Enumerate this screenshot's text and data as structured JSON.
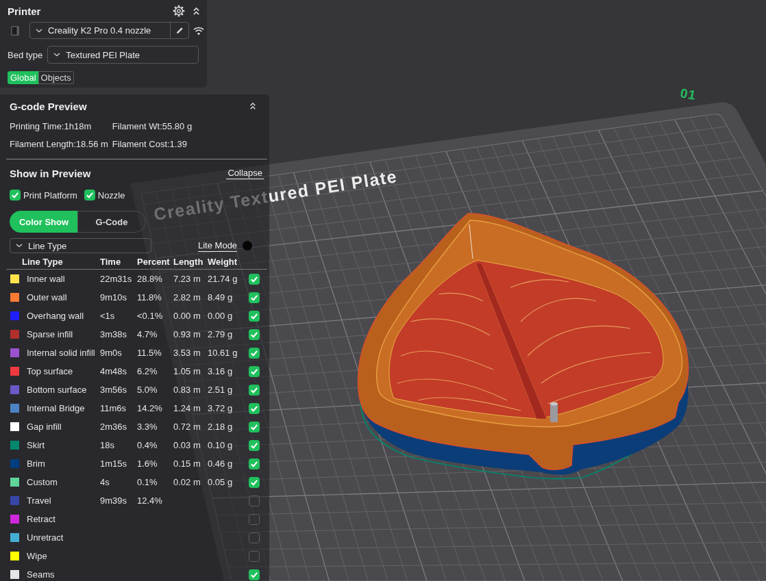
{
  "printer_panel": {
    "title": "Printer",
    "printer": "Creality K2 Pro 0.4 nozzle",
    "bed_type_label": "Bed type",
    "bed_type": "Textured PEI Plate",
    "tabs": [
      {
        "label": "Global",
        "selected": true
      },
      {
        "label": "Objects",
        "selected": false
      }
    ]
  },
  "gcode_panel": {
    "title": "G-code Preview",
    "stats": [
      "Printing Time:1h18m",
      "Filament Wt:55.80 g",
      "Filament Length:18.56 m",
      "Filament Cost:1.39"
    ],
    "show_in_preview": {
      "title": "Show in Preview",
      "collapse_link": "Collapse",
      "options": [
        {
          "label": "Print Platform",
          "checked": true
        },
        {
          "label": "Nozzle",
          "checked": true
        }
      ],
      "modes": [
        {
          "label": "Color Show",
          "selected": true
        },
        {
          "label": "G-Code",
          "selected": false
        }
      ],
      "view_type": "Line Type",
      "lite_mode_link": "Lite Mode"
    },
    "table": {
      "columns": [
        "Line Type",
        "Time",
        "Percent",
        "Length",
        "Weight"
      ],
      "rows": [
        {
          "name": "Inner wall",
          "color": "#ffe34d",
          "time": "22m31s",
          "percent": "28.8%",
          "length": "7.23 m",
          "weight": "21.74 g",
          "checked": true
        },
        {
          "name": "Outer wall",
          "color": "#ff7a33",
          "time": "9m10s",
          "percent": "11.8%",
          "length": "2.82 m",
          "weight": "8.49 g",
          "checked": true
        },
        {
          "name": "Overhang wall",
          "color": "#1f1fff",
          "time": "<1s",
          "percent": "<0.1%",
          "length": "0.00 m",
          "weight": "0.00 g",
          "checked": true
        },
        {
          "name": "Sparse infill",
          "color": "#b0302a",
          "time": "3m38s",
          "percent": "4.7%",
          "length": "0.93 m",
          "weight": "2.79 g",
          "checked": true
        },
        {
          "name": "Internal solid infill",
          "color": "#9b51d0",
          "time": "9m0s",
          "percent": "11.5%",
          "length": "3.53 m",
          "weight": "10.61 g",
          "checked": true
        },
        {
          "name": "Top surface",
          "color": "#f0393f",
          "time": "4m48s",
          "percent": "6.2%",
          "length": "1.05 m",
          "weight": "3.16 g",
          "checked": true
        },
        {
          "name": "Bottom surface",
          "color": "#6a5ac8",
          "time": "3m56s",
          "percent": "5.0%",
          "length": "0.83 m",
          "weight": "2.51 g",
          "checked": true
        },
        {
          "name": "Internal Bridge",
          "color": "#4d83c4",
          "time": "11m6s",
          "percent": "14.2%",
          "length": "1.24 m",
          "weight": "3.72 g",
          "checked": true
        },
        {
          "name": "Gap infill",
          "color": "#ffffff",
          "time": "2m36s",
          "percent": "3.3%",
          "length": "0.72 m",
          "weight": "2.18 g",
          "checked": true
        },
        {
          "name": "Skirt",
          "color": "#00876e",
          "time": "18s",
          "percent": "0.4%",
          "length": "0.03 m",
          "weight": "0.10 g",
          "checked": true
        },
        {
          "name": "Brim",
          "color": "#003e80",
          "time": "1m15s",
          "percent": "1.6%",
          "length": "0.15 m",
          "weight": "0.46 g",
          "checked": true
        },
        {
          "name": "Custom",
          "color": "#5ed699",
          "time": "4s",
          "percent": "0.1%",
          "length": "0.02 m",
          "weight": "0.05 g",
          "checked": true
        },
        {
          "name": "Travel",
          "color": "#3846a8",
          "time": "9m39s",
          "percent": "12.4%",
          "checked": false
        },
        {
          "name": "Retract",
          "color": "#cf28dc",
          "checked": false
        },
        {
          "name": "Unretract",
          "color": "#45aed6",
          "checked": false
        },
        {
          "name": "Wipe",
          "color": "#ffff00",
          "checked": false
        },
        {
          "name": "Seams",
          "color": "#e6e6e9",
          "checked": true
        }
      ]
    }
  },
  "viewport": {
    "plate_label": "Creality Textured PEI Plate",
    "plate_number": "01"
  }
}
